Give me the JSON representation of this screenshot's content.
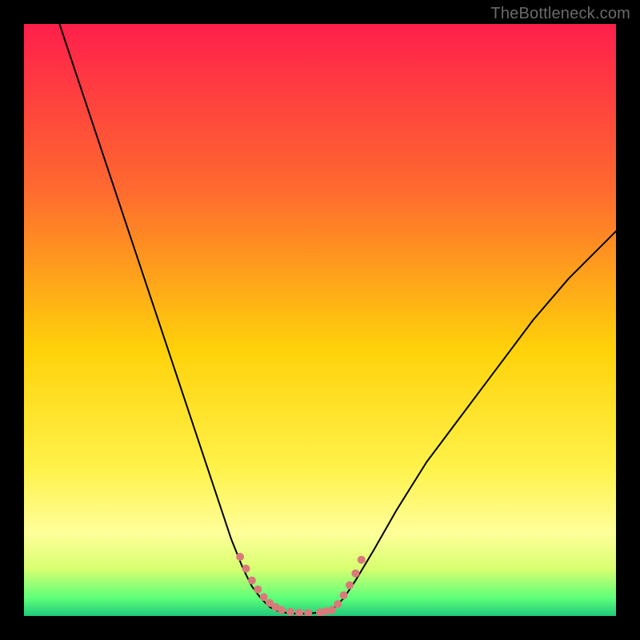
{
  "watermark": {
    "text": "TheBottleneck.com"
  },
  "chart_data": {
    "type": "line",
    "title": "",
    "xlabel": "",
    "ylabel": "",
    "xlim": [
      0,
      100
    ],
    "ylim": [
      0,
      100
    ],
    "grid": false,
    "legend": false,
    "background_gradient_stops": [
      {
        "offset": 0.0,
        "color": "#ff1f4b"
      },
      {
        "offset": 0.28,
        "color": "#ff6a2f"
      },
      {
        "offset": 0.55,
        "color": "#ffd20a"
      },
      {
        "offset": 0.75,
        "color": "#fff24a"
      },
      {
        "offset": 0.86,
        "color": "#ffff9a"
      },
      {
        "offset": 0.92,
        "color": "#d8ff70"
      },
      {
        "offset": 0.97,
        "color": "#5dff7a"
      },
      {
        "offset": 1.0,
        "color": "#20c97a"
      }
    ],
    "series": [
      {
        "name": "left-curve",
        "x": [
          6,
          10,
          14,
          18,
          22,
          26,
          30,
          33,
          35,
          37,
          38.5,
          40,
          41.5,
          43
        ],
        "y": [
          100,
          88,
          76,
          64,
          52,
          40,
          28,
          19,
          13,
          8,
          5,
          3,
          1.5,
          0.8
        ],
        "stroke": "#000000",
        "width": 2
      },
      {
        "name": "valley-floor",
        "x": [
          43,
          44.5,
          46,
          47.5,
          49,
          50.5,
          52
        ],
        "y": [
          0.8,
          0.5,
          0.4,
          0.4,
          0.5,
          0.7,
          1.0
        ],
        "stroke": "#000000",
        "width": 2
      },
      {
        "name": "right-curve",
        "x": [
          52,
          54,
          56,
          59,
          63,
          68,
          74,
          80,
          86,
          92,
          98,
          100
        ],
        "y": [
          1.0,
          3,
          6,
          11,
          18,
          26,
          34,
          42,
          50,
          57,
          63,
          65
        ],
        "stroke": "#000000",
        "width": 2
      }
    ],
    "markers": [
      {
        "name": "left-dash-markers",
        "x": [
          36.5,
          37.5,
          38.5,
          39.5,
          40.5,
          41.5,
          42.5,
          43.5,
          45,
          46.5,
          48
        ],
        "y": [
          10,
          8,
          6,
          4.5,
          3.2,
          2.2,
          1.5,
          1.0,
          0.7,
          0.55,
          0.5
        ],
        "color": "#d97a7a",
        "r": 5
      },
      {
        "name": "right-dash-markers",
        "x": [
          50,
          51,
          52,
          53,
          54,
          55,
          56,
          57
        ],
        "y": [
          0.6,
          0.8,
          1.0,
          2.0,
          3.5,
          5.2,
          7.2,
          9.5
        ],
        "color": "#d97a7a",
        "r": 5
      }
    ]
  }
}
